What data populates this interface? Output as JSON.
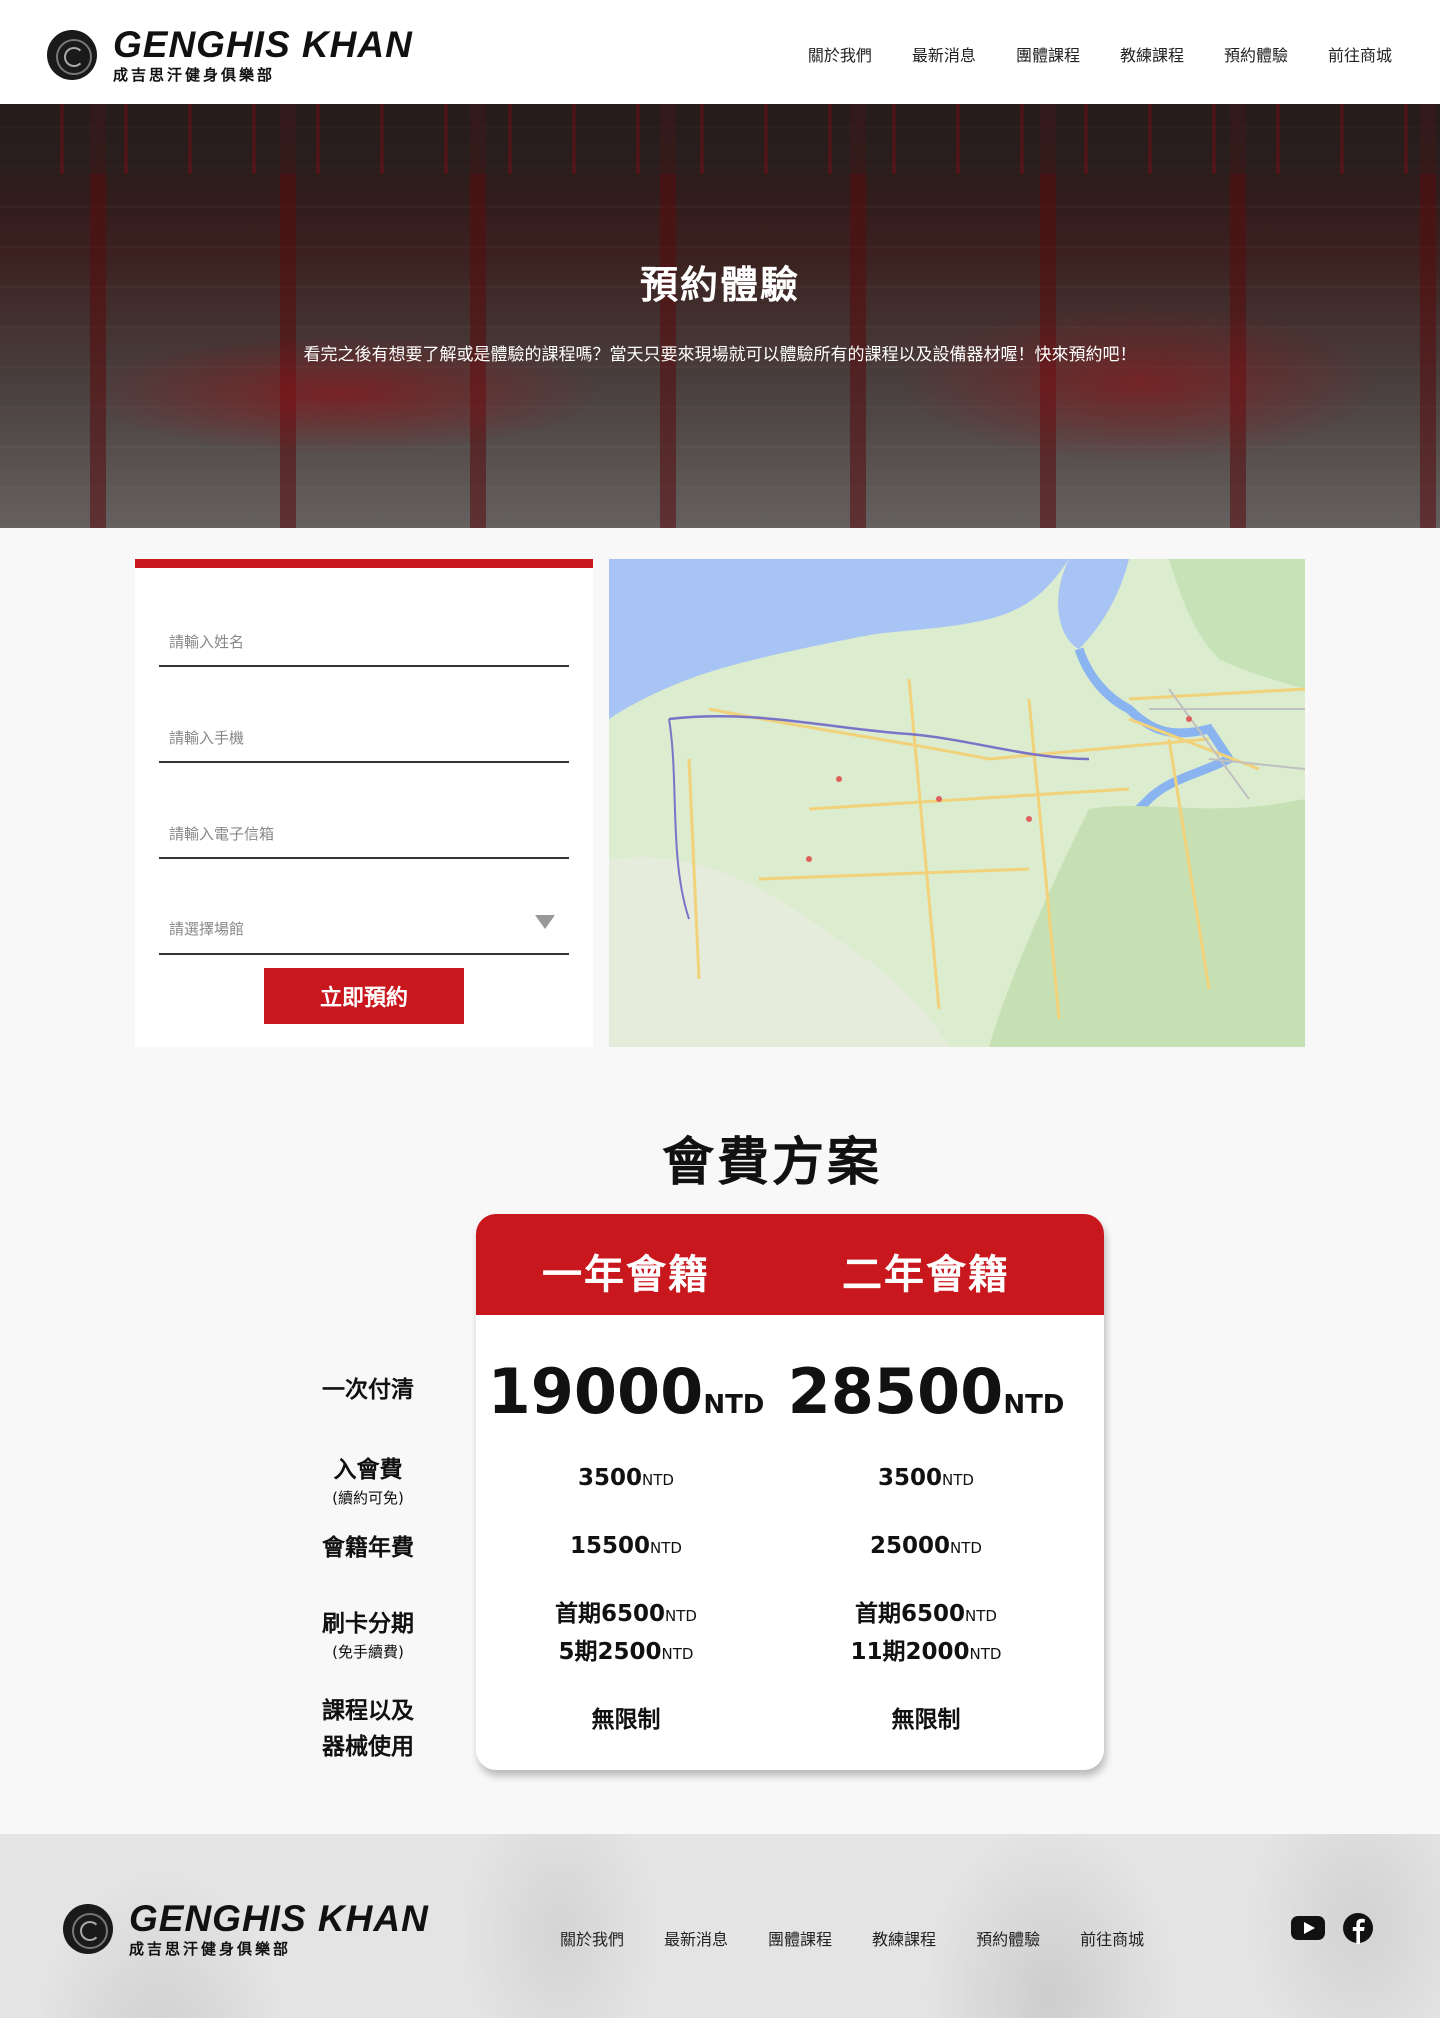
{
  "brand": {
    "name_en": "GENGHIS KHAN",
    "name_zh": "成吉思汗健身俱樂部"
  },
  "nav": [
    "關於我們",
    "最新消息",
    "團體課程",
    "教練課程",
    "預約體驗",
    "前往商城"
  ],
  "hero": {
    "title": "預約體驗",
    "description": "看完之後有想要了解或是體驗的課程嗎？當天只要來現場就可以體驗所有的課程以及設備器材喔！快來預約吧！"
  },
  "form": {
    "name_placeholder": "請輸入姓名",
    "phone_placeholder": "請輸入手機",
    "email_placeholder": "請輸入電子信箱",
    "venue_placeholder": "請選擇場館",
    "submit_label": "立即預約"
  },
  "pricing": {
    "title": "會費方案",
    "plans": [
      "一年會籍",
      "二年會籍"
    ],
    "unit": "NTD",
    "rows": [
      {
        "label": "一次付清",
        "sub": "",
        "values": [
          [
            "19000"
          ],
          [
            "28500"
          ]
        ]
      },
      {
        "label": "入會費",
        "sub": "(續約可免)",
        "values": [
          [
            "3500"
          ],
          [
            "3500"
          ]
        ]
      },
      {
        "label": "會籍年費",
        "sub": "",
        "values": [
          [
            "15500"
          ],
          [
            "25000"
          ]
        ]
      },
      {
        "label": "刷卡分期",
        "sub": "(免手續費)",
        "values": [
          [
            "首期6500",
            "5期2500"
          ],
          [
            "首期6500",
            "11期2000"
          ]
        ]
      },
      {
        "label": "課程以及器械使用",
        "label_line1": "課程以及",
        "label_line2": "器械使用",
        "sub": "",
        "values": [
          [
            "無限制"
          ],
          [
            "無限制"
          ]
        ]
      }
    ]
  },
  "footer": {
    "nav": [
      "關於我們",
      "最新消息",
      "團體課程",
      "教練課程",
      "預約體驗",
      "前往商城"
    ],
    "social_icons": [
      "youtube-icon",
      "facebook-icon"
    ]
  },
  "colors": {
    "accent": "#c8181e",
    "background": "#f8f8f8",
    "text": "#111111"
  }
}
